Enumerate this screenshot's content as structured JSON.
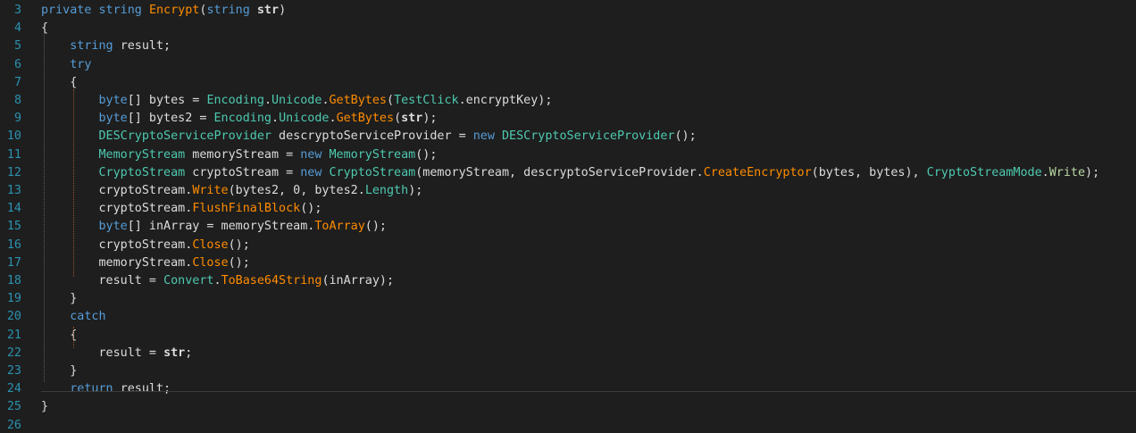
{
  "colors": {
    "background": "#1e1e1e",
    "line_number": "#2b91af",
    "plain": "#dcdcdc",
    "keyword": "#569cd6",
    "method": "#ff8c00",
    "type": "#4ec9b0",
    "enum_member": "#b8d7a3",
    "guide": "#5a5a5a"
  },
  "lines": [
    {
      "no": "3",
      "tokens": [
        [
          "private string ",
          "kw"
        ],
        [
          "Encrypt",
          "m"
        ],
        [
          "(",
          "p"
        ],
        [
          "string ",
          "kw"
        ],
        [
          "str",
          "bold"
        ],
        [
          ")",
          "p"
        ]
      ]
    },
    {
      "no": "4",
      "tokens": [
        [
          "{",
          "p"
        ]
      ]
    },
    {
      "no": "5",
      "tokens": [
        [
          "    ",
          "p"
        ],
        [
          "string ",
          "kw"
        ],
        [
          "result;",
          "p"
        ]
      ]
    },
    {
      "no": "6",
      "tokens": [
        [
          "    ",
          "p"
        ],
        [
          "try",
          "kw"
        ]
      ]
    },
    {
      "no": "7",
      "tokens": [
        [
          "    {",
          "p"
        ]
      ]
    },
    {
      "no": "8",
      "tokens": [
        [
          "        ",
          "p"
        ],
        [
          "byte",
          "kw"
        ],
        [
          "[] bytes = ",
          "p"
        ],
        [
          "Encoding",
          "t"
        ],
        [
          ".",
          "p"
        ],
        [
          "Unicode",
          "t"
        ],
        [
          ".",
          "p"
        ],
        [
          "GetBytes",
          "m"
        ],
        [
          "(",
          "p"
        ],
        [
          "TestClick",
          "t"
        ],
        [
          ".encryptKey);",
          "p"
        ]
      ]
    },
    {
      "no": "9",
      "tokens": [
        [
          "        ",
          "p"
        ],
        [
          "byte",
          "kw"
        ],
        [
          "[] bytes2 = ",
          "p"
        ],
        [
          "Encoding",
          "t"
        ],
        [
          ".",
          "p"
        ],
        [
          "Unicode",
          "t"
        ],
        [
          ".",
          "p"
        ],
        [
          "GetBytes",
          "m"
        ],
        [
          "(",
          "p"
        ],
        [
          "str",
          "bold"
        ],
        [
          ");",
          "p"
        ]
      ]
    },
    {
      "no": "10",
      "tokens": [
        [
          "        ",
          "p"
        ],
        [
          "DESCryptoServiceProvider",
          "t"
        ],
        [
          " descryptoServiceProvider = ",
          "p"
        ],
        [
          "new ",
          "kw"
        ],
        [
          "DESCryptoServiceProvider",
          "t"
        ],
        [
          "();",
          "p"
        ]
      ]
    },
    {
      "no": "11",
      "tokens": [
        [
          "        ",
          "p"
        ],
        [
          "MemoryStream",
          "t"
        ],
        [
          " memoryStream = ",
          "p"
        ],
        [
          "new ",
          "kw"
        ],
        [
          "MemoryStream",
          "t"
        ],
        [
          "();",
          "p"
        ]
      ]
    },
    {
      "no": "12",
      "tokens": [
        [
          "        ",
          "p"
        ],
        [
          "CryptoStream",
          "t"
        ],
        [
          " cryptoStream = ",
          "p"
        ],
        [
          "new ",
          "kw"
        ],
        [
          "CryptoStream",
          "t"
        ],
        [
          "(memoryStream, descryptoServiceProvider.",
          "p"
        ],
        [
          "CreateEncryptor",
          "m"
        ],
        [
          "(bytes, bytes), ",
          "p"
        ],
        [
          "CryptoStreamMode",
          "t"
        ],
        [
          ".",
          "p"
        ],
        [
          "Write",
          "e"
        ],
        [
          ");",
          "p"
        ]
      ]
    },
    {
      "no": "13",
      "tokens": [
        [
          "        cryptoStream.",
          "p"
        ],
        [
          "Write",
          "m"
        ],
        [
          "(bytes2, 0, bytes2.",
          "p"
        ],
        [
          "Length",
          "t"
        ],
        [
          ");",
          "p"
        ]
      ]
    },
    {
      "no": "14",
      "tokens": [
        [
          "        cryptoStream.",
          "p"
        ],
        [
          "FlushFinalBlock",
          "m"
        ],
        [
          "();",
          "p"
        ]
      ]
    },
    {
      "no": "15",
      "tokens": [
        [
          "        ",
          "p"
        ],
        [
          "byte",
          "kw"
        ],
        [
          "[] inArray = memoryStream.",
          "p"
        ],
        [
          "ToArray",
          "m"
        ],
        [
          "();",
          "p"
        ]
      ]
    },
    {
      "no": "16",
      "tokens": [
        [
          "        cryptoStream.",
          "p"
        ],
        [
          "Close",
          "m"
        ],
        [
          "();",
          "p"
        ]
      ]
    },
    {
      "no": "17",
      "tokens": [
        [
          "        memoryStream.",
          "p"
        ],
        [
          "Close",
          "m"
        ],
        [
          "();",
          "p"
        ]
      ]
    },
    {
      "no": "18",
      "tokens": [
        [
          "        result = ",
          "p"
        ],
        [
          "Convert",
          "t"
        ],
        [
          ".",
          "p"
        ],
        [
          "ToBase64String",
          "m"
        ],
        [
          "(inArray);",
          "p"
        ]
      ]
    },
    {
      "no": "19",
      "tokens": [
        [
          "    }",
          "p"
        ]
      ]
    },
    {
      "no": "20",
      "tokens": [
        [
          "    ",
          "p"
        ],
        [
          "catch",
          "kw"
        ]
      ]
    },
    {
      "no": "21",
      "tokens": [
        [
          "    {",
          "p"
        ]
      ]
    },
    {
      "no": "22",
      "tokens": [
        [
          "        result = ",
          "p"
        ],
        [
          "str",
          "bold"
        ],
        [
          ";",
          "p"
        ]
      ]
    },
    {
      "no": "23",
      "tokens": [
        [
          "    }",
          "p"
        ]
      ]
    },
    {
      "no": "24",
      "tokens": [
        [
          "    ",
          "p"
        ],
        [
          "return ",
          "kw"
        ],
        [
          "result;",
          "p"
        ]
      ]
    },
    {
      "no": "25",
      "tokens": [
        [
          "}",
          "p"
        ]
      ]
    },
    {
      "no": "26",
      "tokens": []
    }
  ]
}
